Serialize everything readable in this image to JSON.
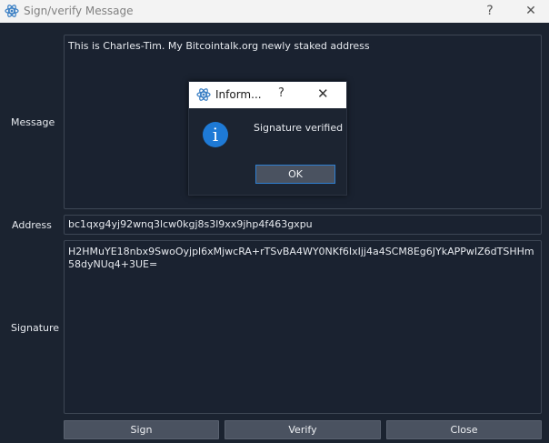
{
  "window": {
    "title": "Sign/verify Message",
    "help_label": "?",
    "close_label": "✕"
  },
  "form": {
    "message_label": "Message",
    "message_value": "This is Charles-Tim. My Bitcointalk.org newly staked address",
    "address_label": "Address",
    "address_value": "bc1qxg4yj92wnq3lcw0kgj8s3l9xx9jhp4f463gxpu",
    "signature_label": "Signature",
    "signature_value": "H2HMuYE18nbx9SwoOyjpl6xMjwcRA+rTSvBA4WY0NKf6IxIjj4a4SCM8Eg6JYkAPPwIZ6dTSHHm58dyNUq4+3UE="
  },
  "buttons": {
    "sign": "Sign",
    "verify": "Verify",
    "close": "Close"
  },
  "dialog": {
    "title": "Inform...",
    "help_label": "?",
    "close_label": "✕",
    "icon_glyph": "i",
    "message": "Signature verified",
    "ok": "OK"
  },
  "colors": {
    "background": "#1b2330",
    "button": "#4a5260",
    "info_blue": "#1e7ad6",
    "focus_border": "#2f7fd0"
  }
}
